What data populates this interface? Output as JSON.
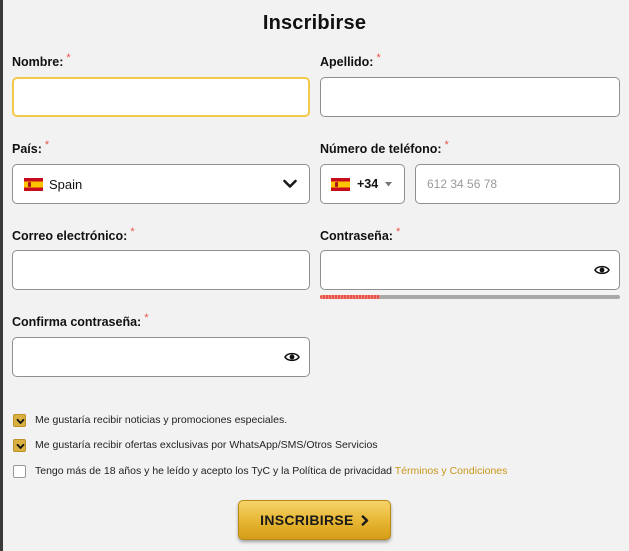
{
  "form": {
    "title": "Inscribirse",
    "nombre": {
      "label": "Nombre:",
      "required_mark": "*",
      "value": ""
    },
    "apellido": {
      "label": "Apellido:",
      "required_mark": "*",
      "value": ""
    },
    "pais": {
      "label": "País:",
      "required_mark": "*",
      "selected": "Spain",
      "flag_icon": "spain-flag-icon"
    },
    "telefono": {
      "label": "Número de teléfono:",
      "required_mark": "*",
      "country_code": "+34",
      "placeholder": "612 34 56 78"
    },
    "correo": {
      "label": "Correo electrónico:",
      "required_mark": "*",
      "value": ""
    },
    "contrasena": {
      "label": "Contraseña:",
      "required_mark": "*",
      "strength_fraction": 0.2,
      "strength_color": "#e8544a"
    },
    "confirma": {
      "label": "Confirma contraseña:",
      "required_mark": "*"
    },
    "options": [
      {
        "text": "Me gustaría recibir noticias y promociones especiales.",
        "checked": true
      },
      {
        "text": "Me gustaría recibir ofertas exclusivas por WhatsApp/SMS/Otros Servicios",
        "checked": true
      },
      {
        "text": "Tengo más de 18 años y he leído y acepto los TyC y la Política de privacidad",
        "link": "Términos y Condiciones",
        "checked": false
      }
    ],
    "submit_label": "INSCRIBIRSE",
    "submit_icon": "chevron-right-icon",
    "accent_color": "#dab042",
    "link_color": "#c9961a"
  }
}
